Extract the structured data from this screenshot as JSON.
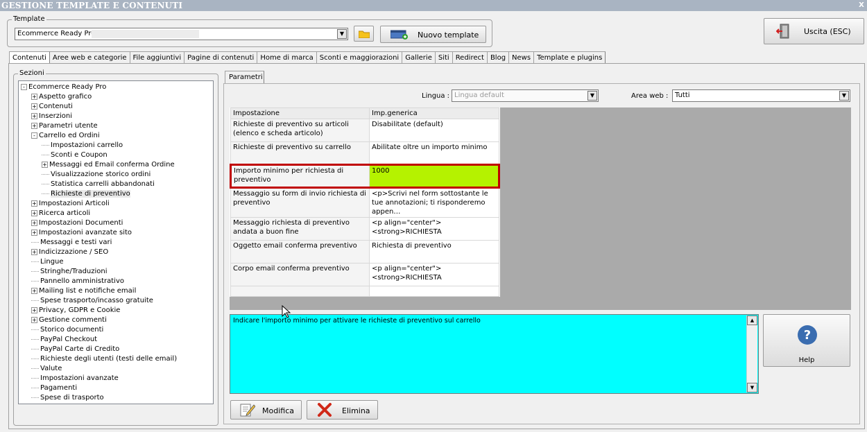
{
  "window": {
    "title": "GESTIONE TEMPLATE E CONTENUTI",
    "close": "X"
  },
  "template": {
    "group_label": "Template",
    "selected": "Ecommerce Ready Pro",
    "new_button": "Nuovo template"
  },
  "exit_button": "Uscita (ESC)",
  "tabs": [
    "Contenuti",
    "Aree web e categorie",
    "File aggiuntivi",
    "Pagine di contenuti",
    "Home di marca",
    "Sconti e maggiorazioni",
    "Gallerie",
    "Siti",
    "Redirect",
    "Blog",
    "News",
    "Template e plugins"
  ],
  "sections": {
    "label": "Sezioni",
    "tree": [
      {
        "label": "Ecommerce Ready Pro",
        "level": 0,
        "exp": "-"
      },
      {
        "label": "Aspetto grafico",
        "level": 1,
        "exp": "+"
      },
      {
        "label": "Contenuti",
        "level": 1,
        "exp": "+"
      },
      {
        "label": "Inserzioni",
        "level": 1,
        "exp": "+"
      },
      {
        "label": "Parametri utente",
        "level": 1,
        "exp": "+"
      },
      {
        "label": "Carrello ed Ordini",
        "level": 1,
        "exp": "-"
      },
      {
        "label": "Impostazioni carrello",
        "level": 2,
        "exp": ""
      },
      {
        "label": "Sconti e Coupon",
        "level": 2,
        "exp": ""
      },
      {
        "label": "Messaggi ed Email conferma Ordine",
        "level": 2,
        "exp": "+"
      },
      {
        "label": "Visualizzazione storico ordini",
        "level": 2,
        "exp": ""
      },
      {
        "label": "Statistica carrelli abbandonati",
        "level": 2,
        "exp": ""
      },
      {
        "label": "Richieste di preventivo",
        "level": 2,
        "exp": "",
        "selected": true
      },
      {
        "label": "Impostazioni Articoli",
        "level": 1,
        "exp": "+"
      },
      {
        "label": "Ricerca articoli",
        "level": 1,
        "exp": "+"
      },
      {
        "label": "Impostazioni Documenti",
        "level": 1,
        "exp": "+"
      },
      {
        "label": "Impostazioni avanzate sito",
        "level": 1,
        "exp": "+"
      },
      {
        "label": "Messaggi e testi vari",
        "level": 1,
        "exp": ""
      },
      {
        "label": "Indicizzazione / SEO",
        "level": 1,
        "exp": "+"
      },
      {
        "label": "Lingue",
        "level": 1,
        "exp": ""
      },
      {
        "label": "Stringhe/Traduzioni",
        "level": 1,
        "exp": ""
      },
      {
        "label": "Pannello amministrativo",
        "level": 1,
        "exp": ""
      },
      {
        "label": "Mailing list e notifiche email",
        "level": 1,
        "exp": "+"
      },
      {
        "label": "Spese trasporto/incasso gratuite",
        "level": 1,
        "exp": ""
      },
      {
        "label": "Privacy, GDPR e Cookie",
        "level": 1,
        "exp": "+"
      },
      {
        "label": "Gestione commenti",
        "level": 1,
        "exp": "+"
      },
      {
        "label": "Storico documenti",
        "level": 1,
        "exp": ""
      },
      {
        "label": "PayPal Checkout",
        "level": 1,
        "exp": ""
      },
      {
        "label": "PayPal Carte di Credito",
        "level": 1,
        "exp": ""
      },
      {
        "label": "Richieste degli utenti (testi delle email)",
        "level": 1,
        "exp": ""
      },
      {
        "label": "Valute",
        "level": 1,
        "exp": ""
      },
      {
        "label": "Impostazioni avanzate",
        "level": 1,
        "exp": ""
      },
      {
        "label": "Pagamenti",
        "level": 1,
        "exp": ""
      },
      {
        "label": "Spese di trasporto",
        "level": 1,
        "exp": ""
      }
    ]
  },
  "params": {
    "tab": "Parametri",
    "lingua_label": "Lingua :",
    "lingua_value": "Lingua default",
    "area_label": "Area web :",
    "area_value": "Tutti",
    "headers": [
      "Impostazione",
      "Imp.generica"
    ],
    "rows": [
      {
        "setting": "Richieste di preventivo su articoli (elenco e scheda articolo)",
        "value": "Disabilitate (default)",
        "h": 33
      },
      {
        "setting": "Richieste di preventivo su carrello",
        "value": "Abilitate oltre un importo minimo",
        "h": 33
      },
      {
        "setting": "Importo minimo per richiesta di preventivo",
        "value": "1000",
        "h": 33,
        "highlight": true
      },
      {
        "setting": "Messaggio su form di invio richiesta di preventivo",
        "value": "<p>Scrivi nel form sottostante le tue annotazioni; ti risponderemo appen…",
        "h": 33
      },
      {
        "setting": "Messaggio richiesta di preventivo andata a buon fine",
        "value": "<p align=\"center\"><strong>RICHIESTA",
        "h": 33
      },
      {
        "setting": "Oggetto email conferma preventivo",
        "value": "Richiesta di preventivo",
        "h": 33
      },
      {
        "setting": "Corpo email conferma preventivo",
        "value": "<p align=\"center\"><strong>RICHIESTA",
        "h": 33
      },
      {
        "setting": "",
        "value": "",
        "h": 15
      }
    ]
  },
  "description": "Indicare l'importo minimo per attivare le richieste di preventivo sul carrello",
  "help_button": "Help",
  "modify_button": "Modifica",
  "delete_button": "Elimina",
  "colors": {
    "highlight_cell": "#b5f200",
    "highlight_border": "#c00000",
    "memo_bg": "#00ffff",
    "help_icon": "#3a6db0"
  }
}
